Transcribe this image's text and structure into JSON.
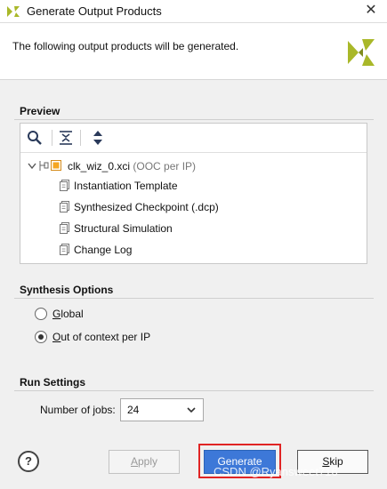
{
  "window": {
    "title": "Generate Output Products",
    "close_glyph": "✕"
  },
  "header": {
    "message": "The following output products will be generated."
  },
  "preview": {
    "section_title": "Preview",
    "root": {
      "name": "clk_wiz_0.xci",
      "scope": "(OOC per IP)"
    },
    "items": [
      {
        "label": "Instantiation Template"
      },
      {
        "label": "Synthesized Checkpoint (.dcp)"
      },
      {
        "label": "Structural Simulation"
      },
      {
        "label": "Change Log"
      }
    ]
  },
  "synthesis": {
    "section_title": "Synthesis Options",
    "options": [
      {
        "mnemonic": "G",
        "rest": "lobal",
        "checked": false
      },
      {
        "mnemonic": "O",
        "rest": "ut of context per IP",
        "checked": true
      }
    ]
  },
  "run": {
    "section_title": "Run Settings",
    "jobs_label_pre": "Number of ",
    "jobs_label_mn": "j",
    "jobs_label_post": "obs:",
    "jobs_value": "24"
  },
  "buttons": {
    "help": "?",
    "apply": {
      "mn": "A",
      "rest": "pply"
    },
    "generate": "Generate",
    "skip": {
      "mn": "S",
      "rest": "kip"
    }
  },
  "watermark": "CSDN @Ryansweet716",
  "colors": {
    "accent": "#3d78d8",
    "highlight_box": "#e02424",
    "xilinx_logo": "#a9b829"
  },
  "icons": {
    "collapse_all": "collapse-all-icon",
    "expand_all": "expand-all-icon",
    "search": "search-icon",
    "file": "file-icon",
    "ip_core": "ip-core-icon"
  }
}
